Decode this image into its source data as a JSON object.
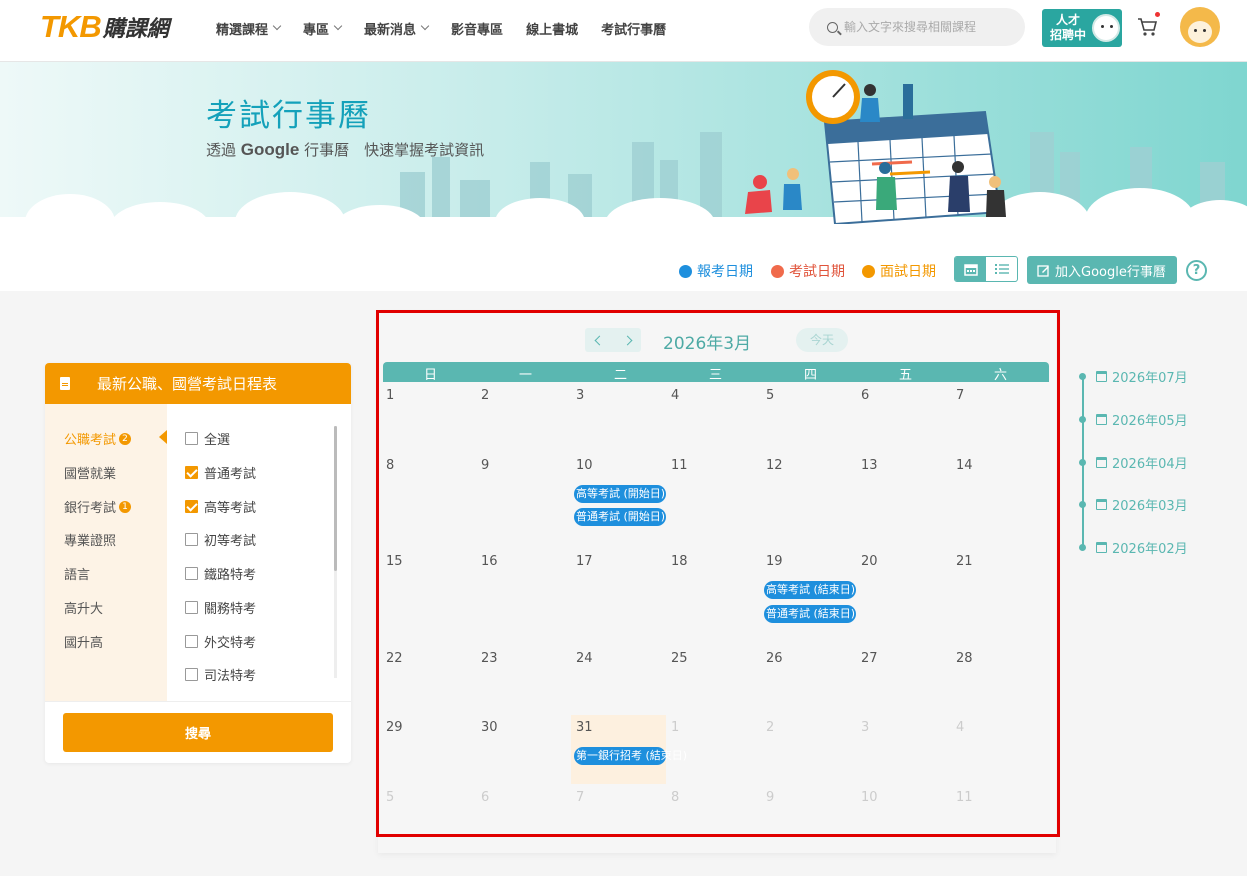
{
  "header": {
    "logo_en": "TKB",
    "logo_cn": "購課網",
    "nav": [
      "精選課程",
      "專區",
      "最新消息",
      "影音專區",
      "線上書城",
      "考試行事曆"
    ],
    "search_placeholder": "輸入文字來搜尋相關課程",
    "recruit": "人才 招聘中"
  },
  "banner": {
    "title": "考試行事曆",
    "subtitle_prefix": "透過",
    "subtitle_brand": "Google",
    "subtitle_suffix": "行事曆　快速掌握考試資訊"
  },
  "legend": {
    "items": [
      {
        "label": "報考日期",
        "color": "#1e8fdd"
      },
      {
        "label": "考試日期",
        "color": "#f06a4b"
      },
      {
        "label": "面試日期",
        "color": "#f39800"
      }
    ],
    "google_button": "加入Google行事曆",
    "help": "?"
  },
  "panel": {
    "title": "最新公職、國營考試日程表",
    "categories": [
      {
        "label": "公職考試",
        "badge": "2"
      },
      {
        "label": "國營就業",
        "badge": ""
      },
      {
        "label": "銀行考試",
        "badge": "1"
      },
      {
        "label": "專業證照",
        "badge": ""
      },
      {
        "label": "語言",
        "badge": ""
      },
      {
        "label": "高升大",
        "badge": ""
      },
      {
        "label": "國升高",
        "badge": ""
      }
    ],
    "options": [
      {
        "label": "全選",
        "checked": false
      },
      {
        "label": "普通考試",
        "checked": true
      },
      {
        "label": "高等考試",
        "checked": true
      },
      {
        "label": "初等考試",
        "checked": false
      },
      {
        "label": "鐵路特考",
        "checked": false
      },
      {
        "label": "關務特考",
        "checked": false
      },
      {
        "label": "外交特考",
        "checked": false
      },
      {
        "label": "司法特考",
        "checked": false
      }
    ],
    "search_button": "搜尋"
  },
  "calendar": {
    "title": "2026年3月",
    "today_button": "今天",
    "weekdays": [
      "日",
      "一",
      "二",
      "三",
      "四",
      "五",
      "六"
    ],
    "weeks": [
      [
        "1",
        "2",
        "3",
        "4",
        "5",
        "6",
        "7"
      ],
      [
        "8",
        "9",
        "10",
        "11",
        "12",
        "13",
        "14"
      ],
      [
        "15",
        "16",
        "17",
        "18",
        "19",
        "20",
        "21"
      ],
      [
        "22",
        "23",
        "24",
        "25",
        "26",
        "27",
        "28"
      ],
      [
        "29",
        "30",
        "31",
        "1",
        "2",
        "3",
        "4"
      ],
      [
        "5",
        "6",
        "7",
        "8",
        "9",
        "10",
        "11"
      ]
    ],
    "events": [
      "高等考試 (開始日)",
      "普通考試 (開始日)",
      "高等考試 (結束日)",
      "普通考試 (結束日)",
      "第一銀行招考 (結束日)"
    ]
  },
  "timeline": [
    "2026年07月",
    "2026年05月",
    "2026年04月",
    "2026年03月",
    "2026年02月"
  ]
}
